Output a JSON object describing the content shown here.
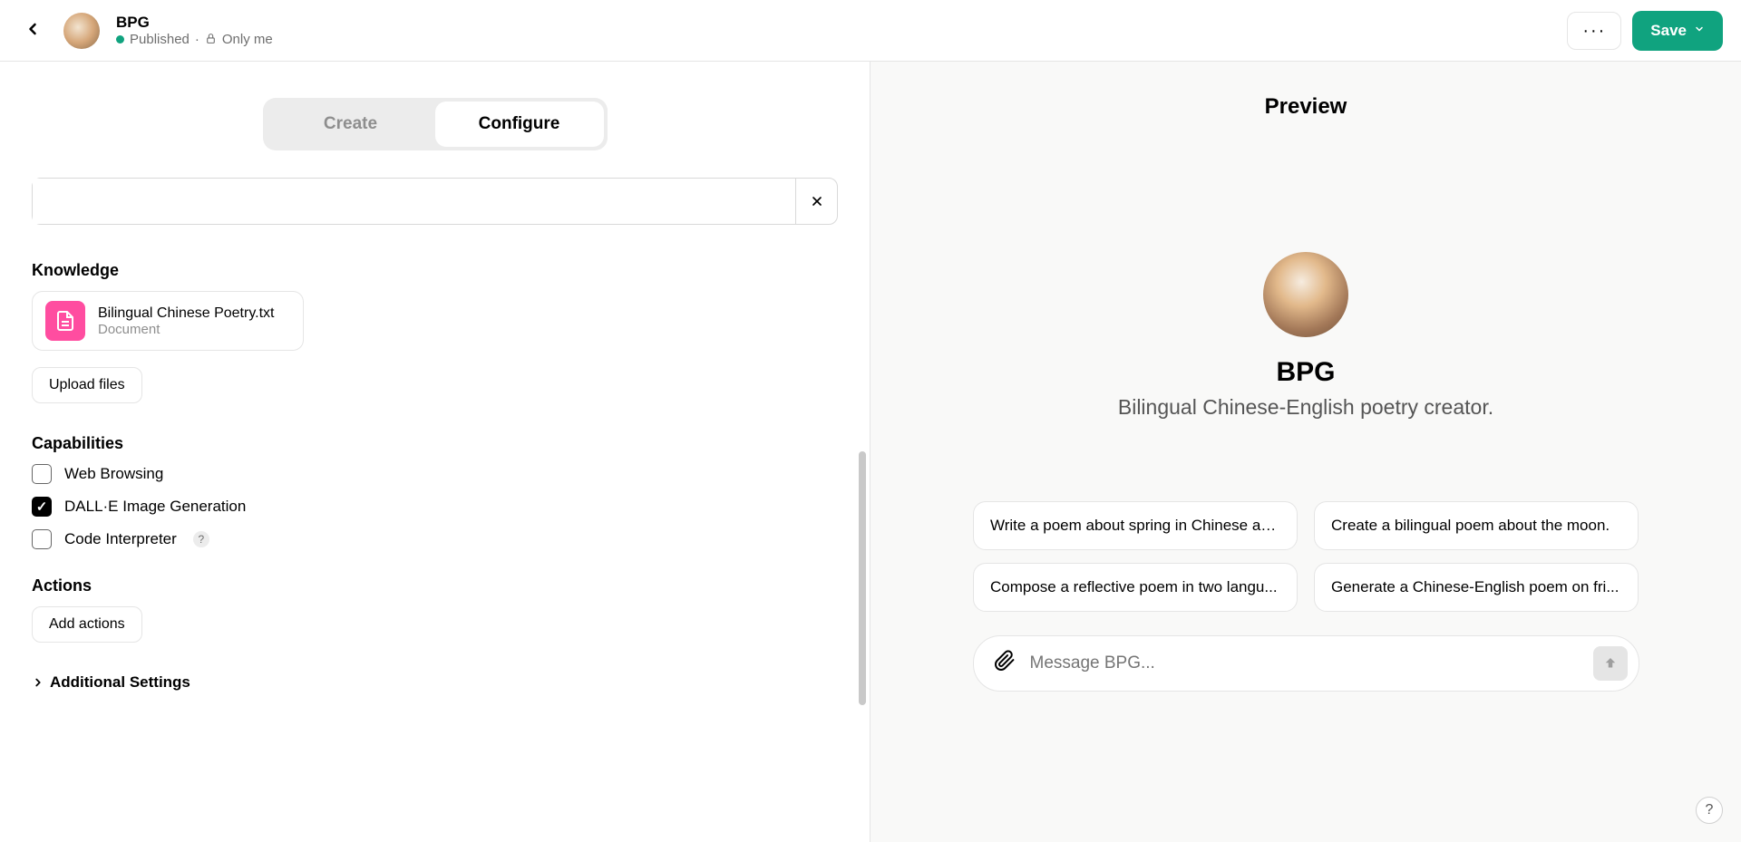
{
  "header": {
    "title": "BPG",
    "status": "Published",
    "visibility": "Only me",
    "separator": "·",
    "save_label": "Save"
  },
  "tabs": {
    "create": "Create",
    "configure": "Configure"
  },
  "knowledge": {
    "label": "Knowledge",
    "file_name": "Bilingual Chinese Poetry.txt",
    "file_type": "Document",
    "upload_label": "Upload files"
  },
  "capabilities": {
    "label": "Capabilities",
    "items": [
      {
        "label": "Web Browsing",
        "checked": false
      },
      {
        "label": "DALL·E Image Generation",
        "checked": true
      },
      {
        "label": "Code Interpreter",
        "checked": false,
        "help": true
      }
    ]
  },
  "actions": {
    "label": "Actions",
    "add_label": "Add actions"
  },
  "additional_label": "Additional Settings",
  "preview": {
    "heading": "Preview",
    "name": "BPG",
    "description": "Bilingual Chinese-English poetry creator.",
    "starters": [
      "Write a poem about spring in Chinese an...",
      "Create a bilingual poem about the moon.",
      "Compose a reflective poem in two langu...",
      "Generate a Chinese-English poem on fri..."
    ],
    "placeholder": "Message BPG...",
    "help": "?"
  }
}
